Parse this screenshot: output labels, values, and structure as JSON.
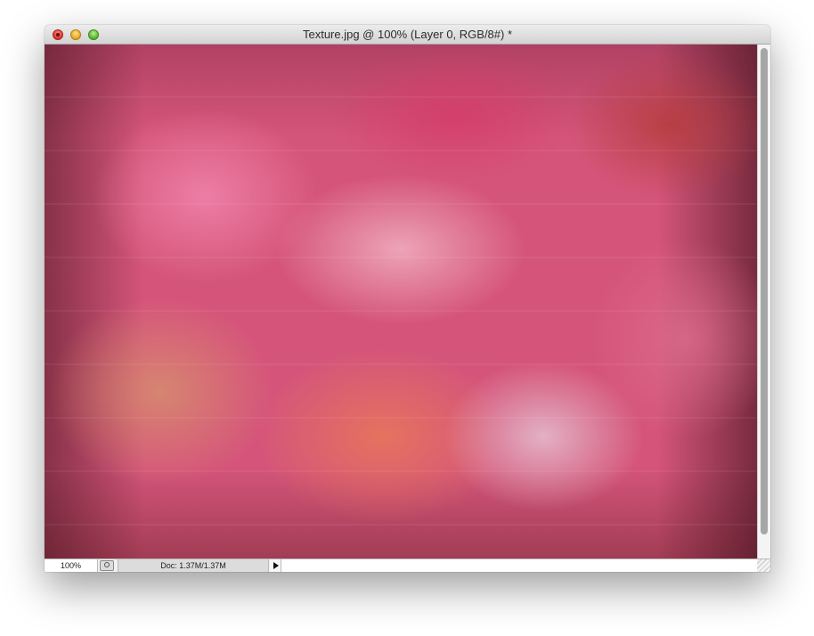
{
  "window": {
    "title": "Texture.jpg @ 100% (Layer 0, RGB/8#) *",
    "controls": {
      "close": "close-button",
      "minimize": "minimize-button",
      "zoom": "zoom-button"
    }
  },
  "canvas": {
    "content": "blurred pink and red texture image"
  },
  "statusbar": {
    "zoom_value": "100%",
    "doc_info": "Doc: 1.37M/1.37M"
  },
  "colors": {
    "close": "#d8342b",
    "minimize": "#e6a51c",
    "zoom": "#55b12b",
    "accent_pink": "#d5557a"
  }
}
